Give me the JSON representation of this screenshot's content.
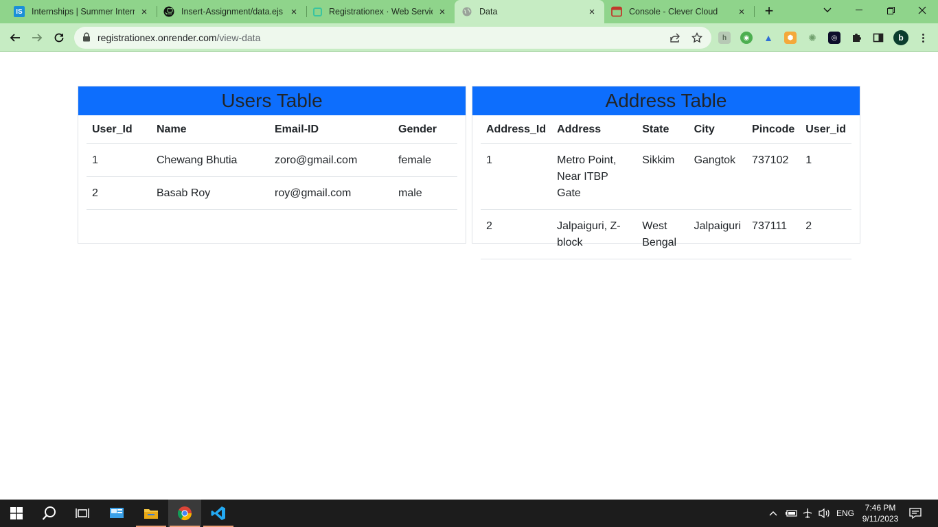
{
  "browser": {
    "tabs": [
      {
        "title": "Internships | Summer Internships",
        "favicon": "IS",
        "active": false
      },
      {
        "title": "Insert-Assignment/data.ejs at main",
        "favicon": "github",
        "active": false
      },
      {
        "title": "Registrationex · Web Service",
        "favicon": "render",
        "active": false
      },
      {
        "title": "Data",
        "favicon": "globe",
        "active": true
      },
      {
        "title": "Console - Clever Cloud",
        "favicon": "clever",
        "active": false
      }
    ],
    "url_host": "registrationex.onrender.com",
    "url_path": "/view-data",
    "profile_initial": "b",
    "accent_color": "#8fd48b"
  },
  "users_table": {
    "title": "Users Table",
    "header_color": "#0d6efd",
    "columns": [
      "User_Id",
      "Name",
      "Email-ID",
      "Gender"
    ],
    "rows": [
      [
        "1",
        "Chewang Bhutia",
        "zoro@gmail.com",
        "female"
      ],
      [
        "2",
        "Basab Roy",
        "roy@gmail.com",
        "male"
      ]
    ]
  },
  "address_table": {
    "title": "Address Table",
    "header_color": "#0d6efd",
    "columns": [
      "Address_Id",
      "Address",
      "State",
      "City",
      "Pincode",
      "User_id"
    ],
    "rows": [
      [
        "1",
        "Metro Point, Near ITBP Gate",
        "Sikkim",
        "Gangtok",
        "737102",
        "1"
      ],
      [
        "2",
        "Jalpaiguri, Z-block",
        "West Bengal",
        "Jalpaiguri",
        "737111",
        "2"
      ]
    ]
  },
  "taskbar": {
    "language": "ENG",
    "time": "7:46 PM",
    "date": "9/11/2023"
  }
}
